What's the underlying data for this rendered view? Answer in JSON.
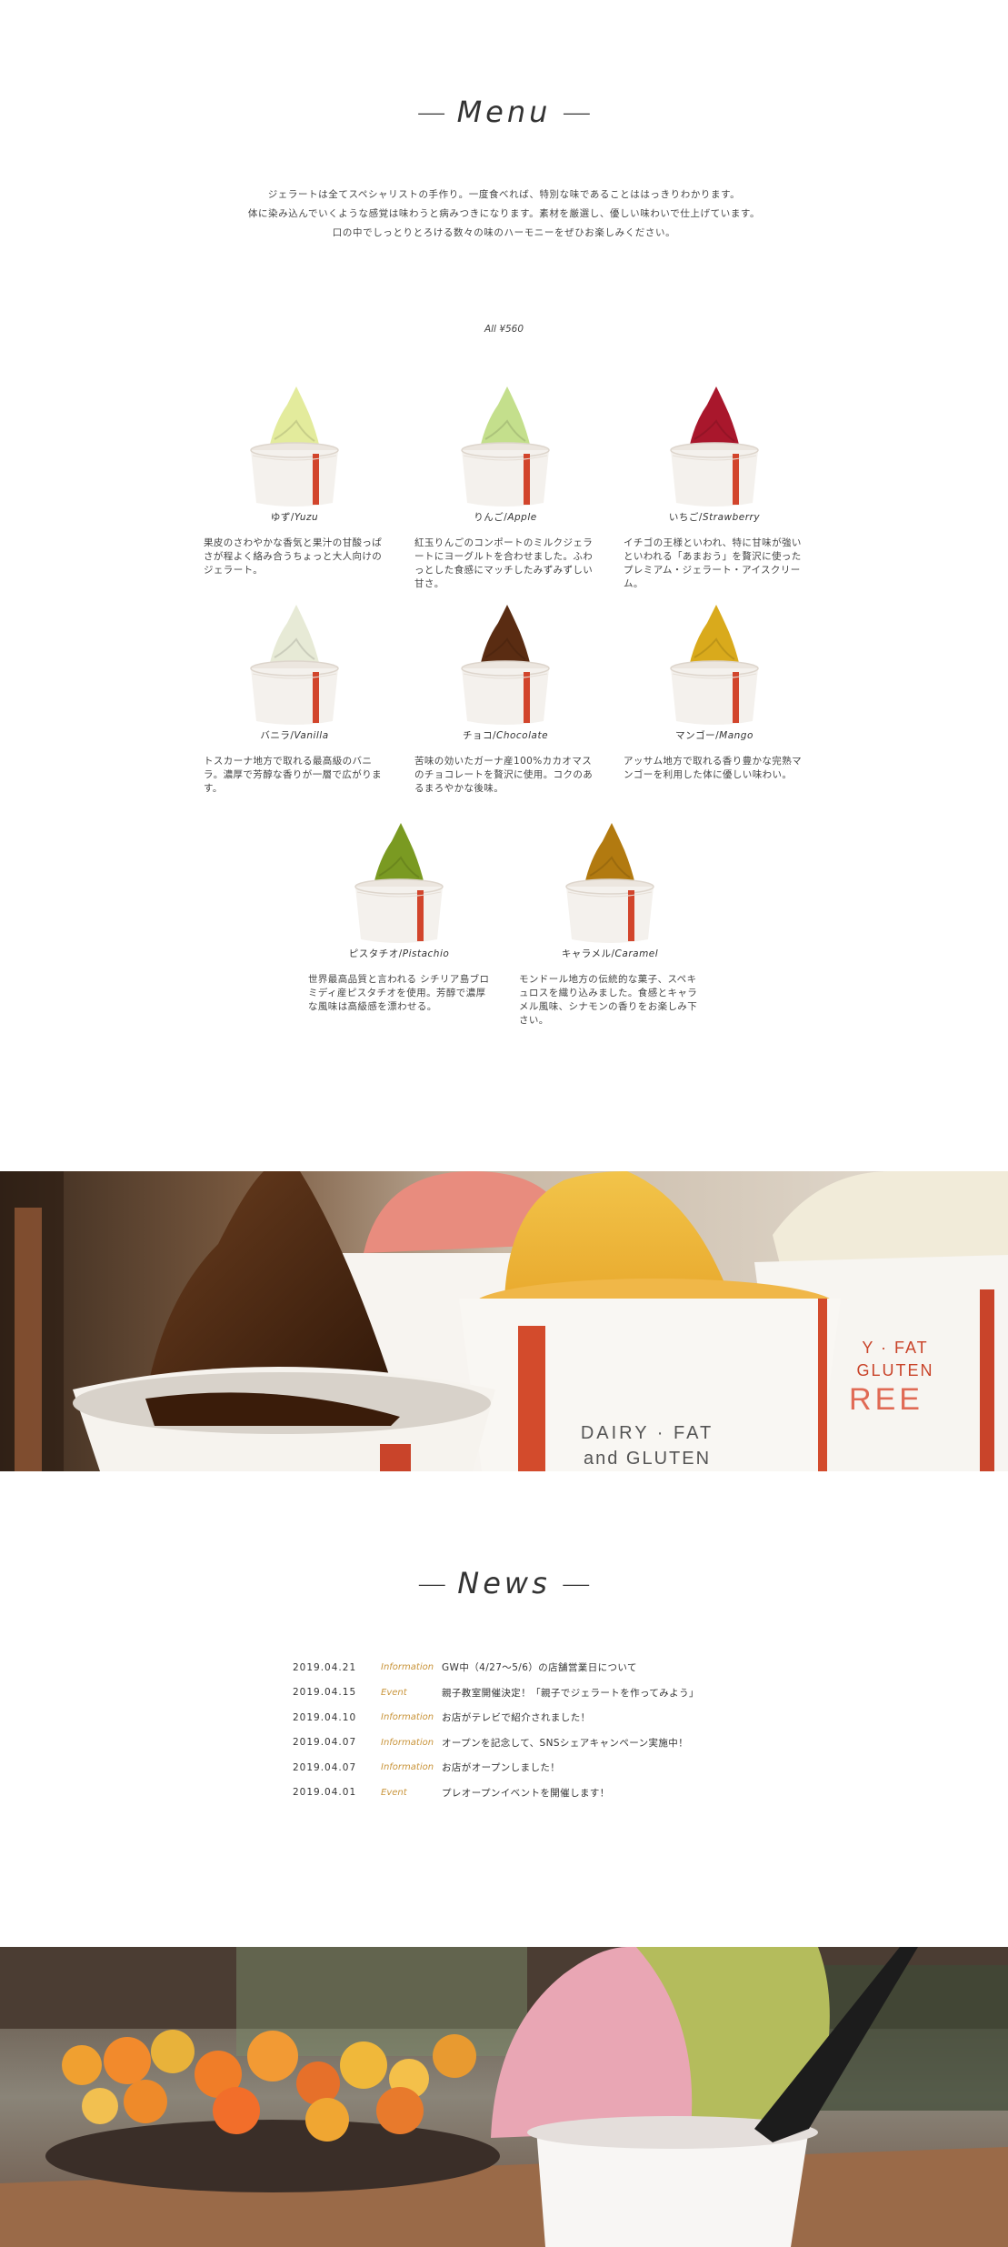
{
  "menu": {
    "title": "Menu",
    "intro": [
      "ジェラートは全てスペシャリストの手作り。一度食べれば、特別な味であることははっきりわかります。",
      "体に染み込んでいくような感覚は味わうと病みつきになります。素材を厳選し、優しい味わいで仕上げています。",
      "口の中でしっとりとろける数々の味のハーモニーをぜひお楽しみください。"
    ],
    "price": "All ¥560",
    "items": [
      {
        "jp": "ゆず/",
        "en": "Yuzu",
        "color": "#e3eb9c",
        "desc": "果皮のさわやかな香気と果汁の甘酸っぱさが程よく絡み合うちょっと大人向けのジェラート。"
      },
      {
        "jp": "りんご/",
        "en": "Apple",
        "color": "#c4df8c",
        "desc": "紅玉りんごのコンポートのミルクジェラートにヨーグルトを合わせました。ふわっとした食感にマッチしたみずみずしい甘さ。"
      },
      {
        "jp": "いちご/",
        "en": "Strawberry",
        "color": "#a9172c",
        "desc": "イチゴの王様といわれ、特に甘味が強いといわれる「あまおう」を贅沢に使ったプレミアム・ジェラート・アイスクリーム。"
      },
      {
        "jp": "バニラ/",
        "en": "Vanilla",
        "color": "#e7ead6",
        "desc": "トスカーナ地方で取れる最高級のバニラ。濃厚で芳醇な香りが一層で広がります。"
      },
      {
        "jp": "チョコ/",
        "en": "Chocolate",
        "color": "#5a2c12",
        "desc": "苦味の効いたガーナ産100%カカオマスのチョコレートを贅沢に使用。コクのあるまろやかな後味。"
      },
      {
        "jp": "マンゴー/",
        "en": "Mango",
        "color": "#d9aa1c",
        "desc": "アッサム地方で取れる香り豊かな完熟マンゴーを利用した体に優しい味わい。"
      },
      {
        "jp": "ピスタチオ/",
        "en": "Pistachio",
        "color": "#7a9a22",
        "desc": "世界最高品質と言われる シチリア島ブロミディ産ピスタチオを使用。芳醇で濃厚な風味は高級感を漂わせる。"
      },
      {
        "jp": "キャラメル/",
        "en": "Caramel",
        "color": "#b27a10",
        "desc": "モンドール地方の伝統的な菓子、スペキュロスを織り込みました。食感とキャラメル風味、シナモンの香りをお楽しみ下さい。"
      }
    ]
  },
  "photo1": {
    "cup_text_line1": "DAIRY · FAT",
    "cup_text_line2": "and GLUTEN",
    "cup_text_right1": "Y · FAT",
    "cup_text_right2": "GLUTEN",
    "cup_text_right3": "REE"
  },
  "news": {
    "title": "News",
    "items": [
      {
        "date": "2019.04.21",
        "category": "Information",
        "text": "GW中（4/27〜5/6）の店舗営業日について"
      },
      {
        "date": "2019.04.15",
        "category": "Event",
        "text": "親子教室開催決定！「親子でジェラートを作ってみよう」"
      },
      {
        "date": "2019.04.10",
        "category": "Information",
        "text": "お店がテレビで紹介されました！"
      },
      {
        "date": "2019.04.07",
        "category": "Information",
        "text": "オープンを記念して、SNSシェアキャンペーン実施中！"
      },
      {
        "date": "2019.04.07",
        "category": "Information",
        "text": "お店がオープンしました！"
      },
      {
        "date": "2019.04.01",
        "category": "Event",
        "text": "プレオープンイベントを開催します！"
      }
    ]
  }
}
